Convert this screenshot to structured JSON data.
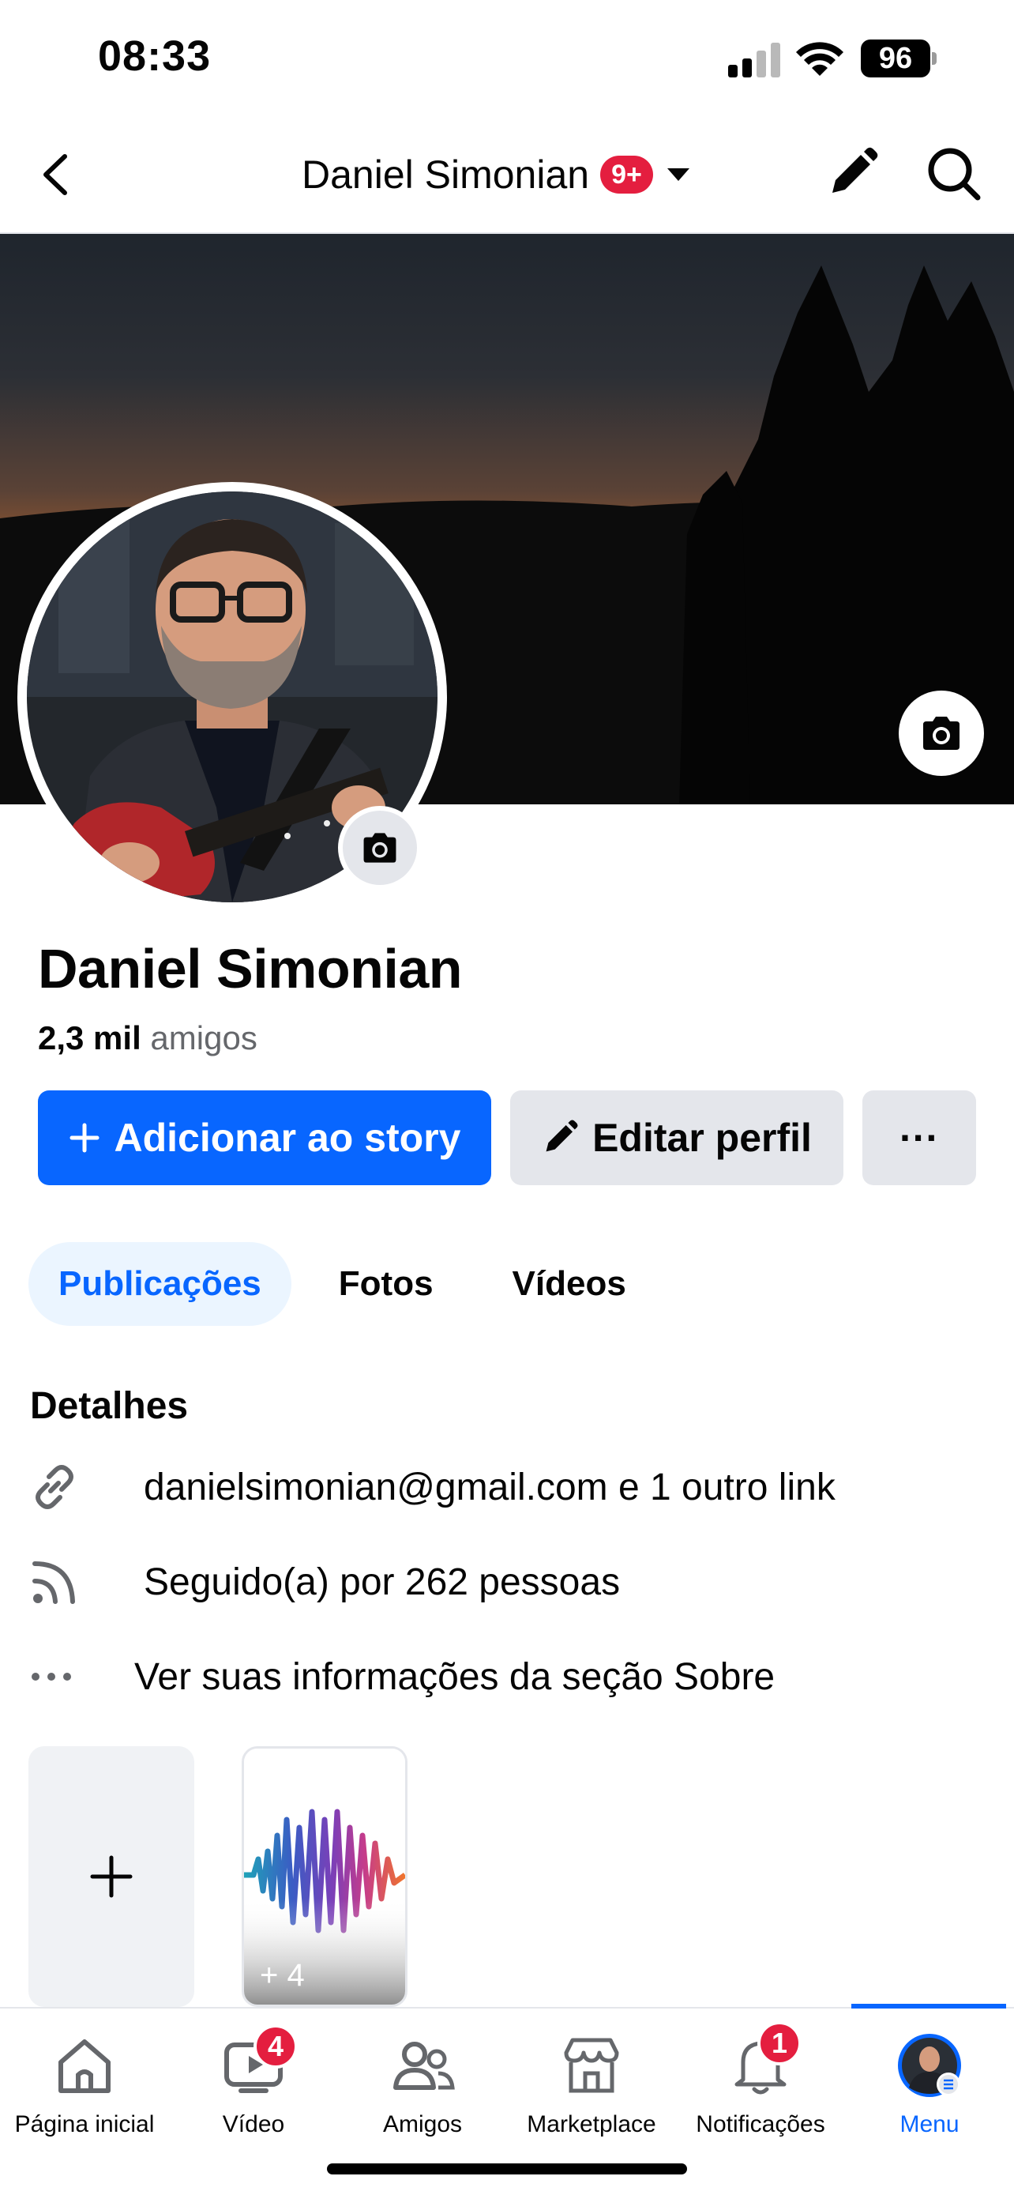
{
  "status_bar": {
    "time": "08:33",
    "battery": "96"
  },
  "header": {
    "title": "Daniel Simonian",
    "notification_count": "9+"
  },
  "profile": {
    "name": "Daniel Simonian",
    "friends_count": "2,3 mil",
    "friends_label": "amigos"
  },
  "actions": {
    "add_story": "Adicionar ao story",
    "edit_profile": "Editar perfil",
    "more": "···"
  },
  "tabs": [
    {
      "label": "Publicações",
      "active": true
    },
    {
      "label": "Fotos",
      "active": false
    },
    {
      "label": "Vídeos",
      "active": false
    }
  ],
  "details": {
    "title": "Detalhes",
    "items": [
      {
        "icon": "link-icon",
        "text": "danielsimonian@gmail.com e 1 outro link"
      },
      {
        "icon": "rss-icon",
        "text": "Seguido(a) por 262 pessoas"
      },
      {
        "icon": "more-dots-icon",
        "text": "Ver suas informações da seção Sobre"
      }
    ]
  },
  "featured": {
    "count_label": "+ 4"
  },
  "bottom_nav": [
    {
      "label": "Página inicial",
      "icon": "home-icon"
    },
    {
      "label": "Vídeo",
      "icon": "video-icon",
      "badge": "4"
    },
    {
      "label": "Amigos",
      "icon": "friends-icon"
    },
    {
      "label": "Marketplace",
      "icon": "marketplace-icon"
    },
    {
      "label": "Notificações",
      "icon": "bell-icon",
      "badge": "1"
    },
    {
      "label": "Menu",
      "icon": "menu-avatar-icon",
      "active": true
    }
  ],
  "colors": {
    "accent": "#0866ff",
    "badge": "#e41e3f",
    "muted": "#65676b",
    "button_gray": "#e4e6eb"
  }
}
